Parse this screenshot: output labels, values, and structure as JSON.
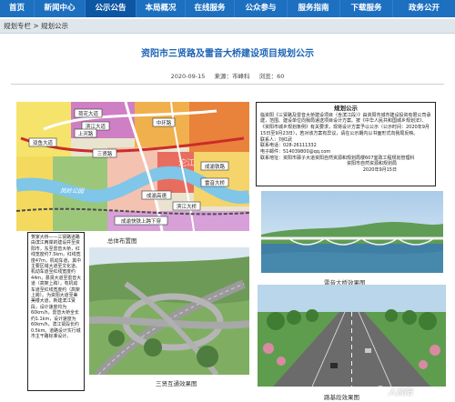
{
  "nav": {
    "items": [
      "首页",
      "新闻中心",
      "公示公告",
      "本局概况",
      "在线服务",
      "公众参与",
      "服务指南",
      "下载服务",
      "政务公开"
    ],
    "active_index": 2,
    "colors": {
      "bar": "#1d6fc0",
      "active": "#0d56a3"
    }
  },
  "breadcrumb": {
    "text": "规划专栏 > 规划公示"
  },
  "article": {
    "title": "资阳市三贤路及雷音大桥建设项目规划公示",
    "date": "2020-09-15",
    "source": "来源：市峰科",
    "views": "浏览：60"
  },
  "notice": {
    "title": "规划公示",
    "body": "临资阳《三贤路及雷音大桥建设项目（含滨江段）》由资阳市城市建设投资有限公司承建，范围、建设单位向我局递送项目设计方案。按《中华人民共和国城乡规划法》、《资阳市城乡规划条例》有关要求，现将设计方案予以公示（公示时间：2020年9月15日至9月23日），若对该方案有异议，请在公示期内以书面形式向我局反映。",
    "contact": "联系人：刘红武",
    "phone": "联系电话：028-26111332",
    "email": "电子邮件：514039800@qq.com",
    "address": "联系地址：资阳市驿子大道资阳自然资源和规划局楼607室政工程规划管理科",
    "org": "资阳市自然资源和规划局",
    "date": "2020年9月15日"
  },
  "left_note": {
    "text": "贺家大桥——三贤路道路由滨江两岸的建设并至资阳市，东至雷音大桥，红线宽度约7.5km，红线宽度47m，机动车道，其中主要区域大道至文化道。机动车道至红线宽度约44m，慕贤大道至雷音大道（高架上跨），有机动车道至红线宽度约（高架上跨）。为资阳大道至美美楼大道，新建滨江贤段，设计速度均为60km/h，雷音大桥全长约1.1km，设计速度为60km/h，滨江贤段长约0.5km。道路设计实行城市主干路标准设计。"
  },
  "captions": {
    "overview": "总体布置图",
    "bridge": "雷音大桥效果图",
    "interchange": "三贤互通效果图",
    "road": "路基段效果图"
  },
  "map_labels": [
    "荷花大道",
    "滨江大道",
    "中环路",
    "上河路",
    "双鱼大道",
    "雷音大桥",
    "三贤路",
    "滨江大桥",
    "成渝铁路",
    "凤岭公园",
    "沱江",
    "成渝高速",
    "成渝快铁上跨下穿"
  ],
  "watermark": "人资阳"
}
